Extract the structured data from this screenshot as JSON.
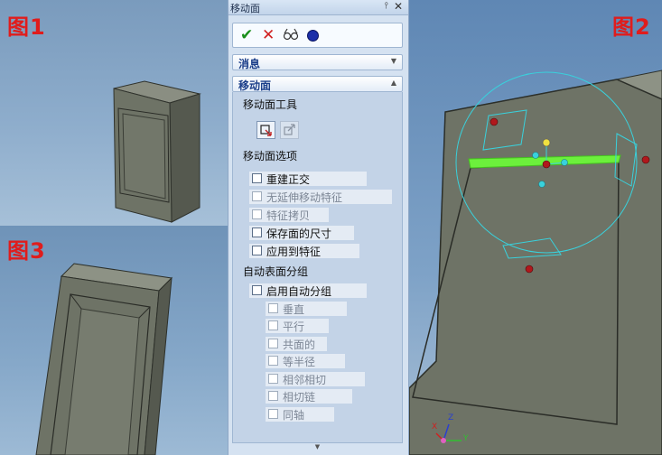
{
  "figure_labels": {
    "fig1": "图1",
    "fig2": "图2",
    "fig3": "图3"
  },
  "panel": {
    "title": "移动面",
    "pin_icon": "pin-icon",
    "close_icon": "close-icon",
    "actions": {
      "ok": "✔",
      "cancel": "✕",
      "preview": "preview-glasses-icon",
      "detail": "detail-dot-icon"
    },
    "sections": {
      "message": {
        "label": "消息",
        "collapsed": true
      },
      "move_face": {
        "label": "移动面",
        "collapsed": false
      }
    },
    "tools_group": {
      "title": "移动面工具"
    },
    "options_group": {
      "title": "移动面选项",
      "items": [
        {
          "label": "重建正交",
          "checked": false,
          "enabled": true
        },
        {
          "label": "无延伸移动特征",
          "checked": false,
          "enabled": false
        },
        {
          "label": "特征拷贝",
          "checked": false,
          "enabled": false
        },
        {
          "label": "保存面的尺寸",
          "checked": false,
          "enabled": true
        },
        {
          "label": "应用到特征",
          "checked": false,
          "enabled": true
        }
      ]
    },
    "auto_group": {
      "title": "自动表面分组",
      "enable": {
        "label": "启用自动分组",
        "checked": false,
        "enabled": true
      },
      "items": [
        {
          "label": "垂直",
          "checked": false,
          "enabled": false
        },
        {
          "label": "平行",
          "checked": false,
          "enabled": false
        },
        {
          "label": "共面的",
          "checked": false,
          "enabled": false
        },
        {
          "label": "等半径",
          "checked": false,
          "enabled": false
        },
        {
          "label": "相邻相切",
          "checked": false,
          "enabled": false
        },
        {
          "label": "相切链",
          "checked": false,
          "enabled": false
        },
        {
          "label": "同轴",
          "checked": false,
          "enabled": false
        }
      ]
    }
  },
  "axis_triad": {
    "z": "Z",
    "y": "Y",
    "x": "X"
  },
  "colors": {
    "figure_label": "#e01c1c",
    "model_face": "#6e7366",
    "handle_ring": "#39d1dc",
    "highlight_edge": "#6cf03c",
    "handle_point": "#b0181c"
  }
}
